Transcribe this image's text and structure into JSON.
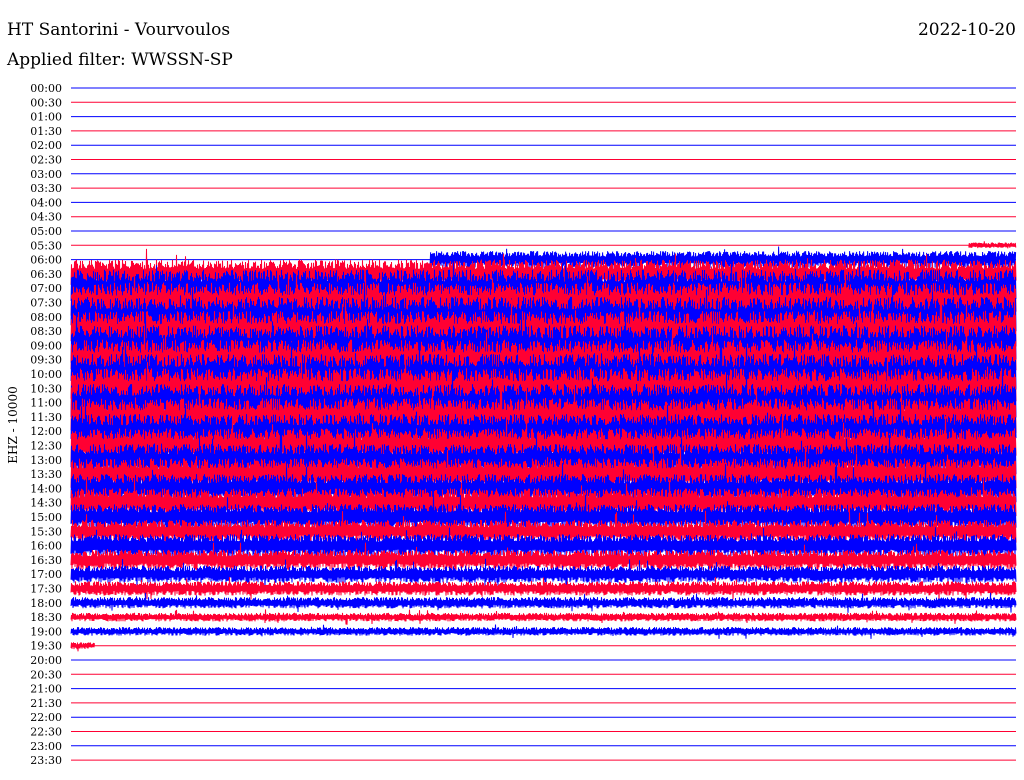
{
  "header": {
    "station": "HT Santorini - Vourvoulos",
    "date": "2022-10-20",
    "filter": "Applied filter: WWSSN-SP"
  },
  "chart_data": {
    "type": "line",
    "title": "HT Santorini - Vourvoulos",
    "ylabel": "EHZ - 10000",
    "filter": "WWSSN-SP",
    "date": "2022-10-20",
    "row_labels": [
      "00:00",
      "00:30",
      "01:00",
      "01:30",
      "02:00",
      "02:30",
      "03:00",
      "03:30",
      "04:00",
      "04:30",
      "05:00",
      "05:30",
      "06:00",
      "06:30",
      "07:00",
      "07:30",
      "08:00",
      "08:30",
      "09:00",
      "09:30",
      "10:00",
      "10:30",
      "11:00",
      "11:30",
      "12:00",
      "12:30",
      "13:00",
      "13:30",
      "14:00",
      "14:30",
      "15:00",
      "15:30",
      "16:00",
      "16:30",
      "17:00",
      "17:30",
      "18:00",
      "18:30",
      "19:00",
      "19:30",
      "20:00",
      "20:30",
      "21:00",
      "21:30",
      "22:00",
      "22:30",
      "23:00",
      "23:30"
    ],
    "row_colors": [
      "#0000ff",
      "#ff0033"
    ],
    "traces": [
      {
        "row": "05:30",
        "start": 0.95,
        "end": 1.0,
        "amplitude": 0.4
      },
      {
        "row": "06:00",
        "start": 0.38,
        "end": 1.0,
        "amplitude": 1.2
      },
      {
        "row": "06:30",
        "start": 0.0,
        "end": 1.0,
        "amplitude": 2.0
      },
      {
        "row": "07:00",
        "start": 0.0,
        "end": 1.0,
        "amplitude": 2.6
      },
      {
        "row": "07:30",
        "start": 0.0,
        "end": 1.0,
        "amplitude": 2.8
      },
      {
        "row": "08:00",
        "start": 0.0,
        "end": 1.0,
        "amplitude": 2.8
      },
      {
        "row": "08:30",
        "start": 0.0,
        "end": 1.0,
        "amplitude": 2.8
      },
      {
        "row": "09:00",
        "start": 0.0,
        "end": 1.0,
        "amplitude": 2.8
      },
      {
        "row": "09:30",
        "start": 0.0,
        "end": 1.0,
        "amplitude": 2.8
      },
      {
        "row": "10:00",
        "start": 0.0,
        "end": 1.0,
        "amplitude": 2.8
      },
      {
        "row": "10:30",
        "start": 0.0,
        "end": 1.0,
        "amplitude": 2.8
      },
      {
        "row": "11:00",
        "start": 0.0,
        "end": 1.0,
        "amplitude": 2.6
      },
      {
        "row": "11:30",
        "start": 0.0,
        "end": 1.0,
        "amplitude": 2.6
      },
      {
        "row": "12:00",
        "start": 0.0,
        "end": 1.0,
        "amplitude": 2.4
      },
      {
        "row": "12:30",
        "start": 0.0,
        "end": 1.0,
        "amplitude": 2.4
      },
      {
        "row": "13:00",
        "start": 0.0,
        "end": 1.0,
        "amplitude": 2.2
      },
      {
        "row": "13:30",
        "start": 0.0,
        "end": 1.0,
        "amplitude": 2.2
      },
      {
        "row": "14:00",
        "start": 0.0,
        "end": 1.0,
        "amplitude": 2.0
      },
      {
        "row": "14:30",
        "start": 0.0,
        "end": 1.0,
        "amplitude": 2.0
      },
      {
        "row": "15:00",
        "start": 0.0,
        "end": 1.0,
        "amplitude": 1.8
      },
      {
        "row": "15:30",
        "start": 0.0,
        "end": 1.0,
        "amplitude": 1.6
      },
      {
        "row": "16:00",
        "start": 0.0,
        "end": 1.0,
        "amplitude": 1.6
      },
      {
        "row": "16:30",
        "start": 0.0,
        "end": 1.0,
        "amplitude": 1.4
      },
      {
        "row": "17:00",
        "start": 0.0,
        "end": 1.0,
        "amplitude": 1.2
      },
      {
        "row": "17:30",
        "start": 0.0,
        "end": 1.0,
        "amplitude": 1.0
      },
      {
        "row": "18:00",
        "start": 0.0,
        "end": 1.0,
        "amplitude": 0.8
      },
      {
        "row": "18:30",
        "start": 0.0,
        "end": 1.0,
        "amplitude": 0.6
      },
      {
        "row": "19:00",
        "start": 0.0,
        "end": 1.0,
        "amplitude": 0.6
      },
      {
        "row": "19:30",
        "start": 0.0,
        "end": 0.025,
        "amplitude": 0.5
      }
    ]
  }
}
